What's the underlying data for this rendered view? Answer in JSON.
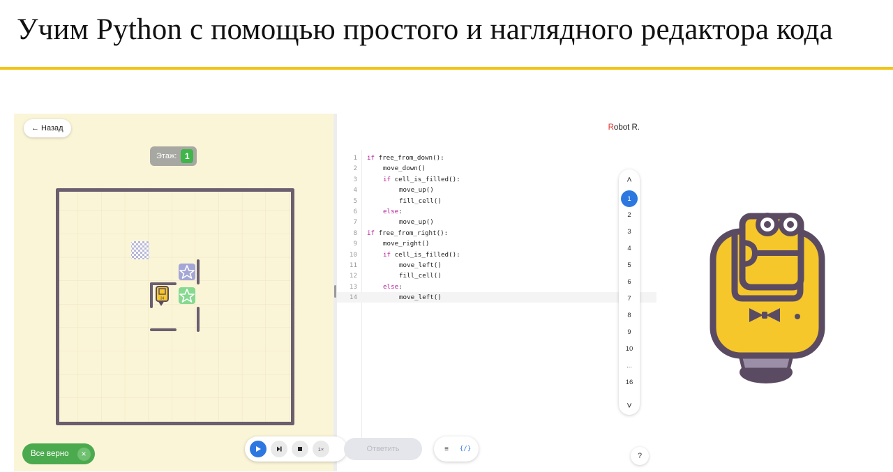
{
  "slide": {
    "title": "Учим Python с помощью простого и наглядного редактора кода",
    "accent_color": "#f2c318"
  },
  "field": {
    "back_label": "← Назад",
    "floor_label": "Этаж:",
    "floor_value": "1",
    "status_text": "Все верно",
    "status_close": "×",
    "background": "#fbf5d8"
  },
  "editor": {
    "brand_initial": "R",
    "brand_rest": "obot R.",
    "lines": [
      {
        "n": "1",
        "indent": 0,
        "kw": "if",
        "text": " free_from_down():"
      },
      {
        "n": "2",
        "indent": 1,
        "kw": "",
        "text": "move_down()"
      },
      {
        "n": "3",
        "indent": 1,
        "kw": "if",
        "text": " cell_is_filled():"
      },
      {
        "n": "4",
        "indent": 2,
        "kw": "",
        "text": "move_up()"
      },
      {
        "n": "5",
        "indent": 2,
        "kw": "",
        "text": "fill_cell()"
      },
      {
        "n": "6",
        "indent": 1,
        "kw": "else",
        "text": ":"
      },
      {
        "n": "7",
        "indent": 2,
        "kw": "",
        "text": "move_up()"
      },
      {
        "n": "8",
        "indent": 0,
        "kw": "if",
        "text": " free_from_right():"
      },
      {
        "n": "9",
        "indent": 1,
        "kw": "",
        "text": "move_right()"
      },
      {
        "n": "10",
        "indent": 1,
        "kw": "if",
        "text": " cell_is_filled():"
      },
      {
        "n": "11",
        "indent": 2,
        "kw": "",
        "text": "move_left()"
      },
      {
        "n": "12",
        "indent": 2,
        "kw": "",
        "text": "fill_cell()"
      },
      {
        "n": "13",
        "indent": 1,
        "kw": "else",
        "text": ":"
      },
      {
        "n": "14",
        "indent": 2,
        "kw": "",
        "text": "move_left()"
      }
    ],
    "active_line": 14,
    "task_nav": {
      "up_icon": "˄",
      "down_icon": "˅",
      "items": [
        "1",
        "2",
        "3",
        "4",
        "5",
        "6",
        "7",
        "8",
        "9",
        "10",
        "...",
        "16"
      ],
      "active_index": 0
    },
    "help_label": "?"
  },
  "toolbar": {
    "play_icon": "play-icon",
    "step_icon": "step-icon",
    "stop_icon": "stop-icon",
    "speed_label": "1×",
    "answer_label": "Ответить",
    "format_icon": "≡",
    "snippet_icon": "{/}"
  },
  "board": {
    "robot_label": "34",
    "grid_color": "#ece3c0",
    "wall_color": "#6b5e6e",
    "star_colors": [
      "#a4a6d6",
      "#86d98f"
    ]
  },
  "mascot": {
    "body_color": "#f5c72b",
    "outline_color": "#5b4b62"
  }
}
